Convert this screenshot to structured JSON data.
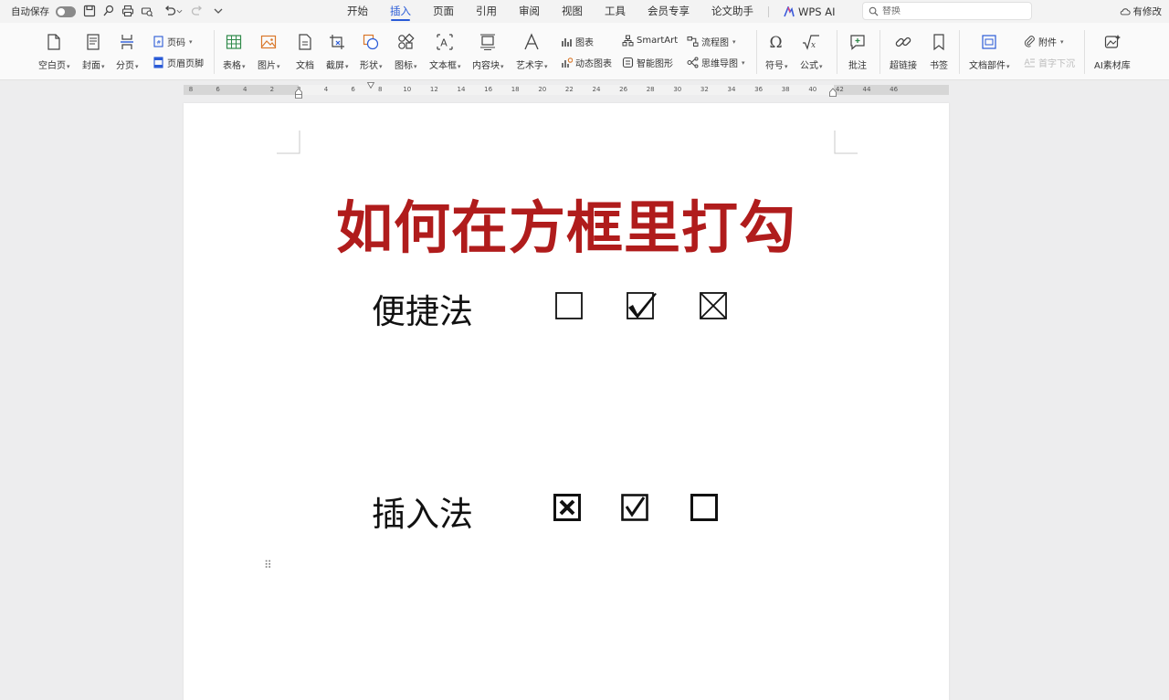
{
  "titlebar": {
    "autosave_label": "自动保存",
    "tabs": [
      {
        "label": "开始"
      },
      {
        "label": "插入"
      },
      {
        "label": "页面"
      },
      {
        "label": "引用"
      },
      {
        "label": "审阅"
      },
      {
        "label": "视图"
      },
      {
        "label": "工具"
      },
      {
        "label": "会员专享"
      },
      {
        "label": "论文助手"
      }
    ],
    "active_tab": "插入",
    "wps_ai_label": "WPS AI",
    "search_placeholder": "替换",
    "status": "有修改"
  },
  "ribbon": {
    "blank_page": "空白页",
    "cover": "封面",
    "page_break": "分页",
    "page_number": "页码",
    "header_footer": "页眉页脚",
    "table": "表格",
    "picture": "图片",
    "document": "文档",
    "screenshot": "截屏",
    "shape": "形状",
    "icon": "图标",
    "textbox": "文本框",
    "content_block": "内容块",
    "wordart": "艺术字",
    "chart": "图表",
    "dynamic_chart": "动态图表",
    "smartart": "SmartArt",
    "smart_shape": "智能图形",
    "flowchart": "流程图",
    "mindmap": "思维导图",
    "symbol": "符号",
    "formula": "公式",
    "comment": "批注",
    "hyperlink": "超链接",
    "bookmark": "书签",
    "doc_parts": "文档部件",
    "attachment": "附件",
    "drop_cap": "首字下沉",
    "ai_material": "AI素材库"
  },
  "ruler": {
    "ticks": [
      "8",
      "6",
      "4",
      "2",
      "2",
      "4",
      "6",
      "8",
      "10",
      "12",
      "14",
      "16",
      "18",
      "20",
      "22",
      "24",
      "26",
      "28",
      "30",
      "32",
      "34",
      "36",
      "38",
      "40",
      "42",
      "44",
      "46"
    ]
  },
  "document": {
    "title": "如何在方框里打勾",
    "row1": {
      "label": "便捷法",
      "boxes": [
        "empty",
        "check",
        "cross"
      ]
    },
    "row2": {
      "label": "插入法",
      "boxes": [
        "cross-bold",
        "check",
        "empty-bold"
      ]
    }
  },
  "colors": {
    "title_red": "#b01c1c",
    "accent_blue": "#2a5bd7"
  }
}
